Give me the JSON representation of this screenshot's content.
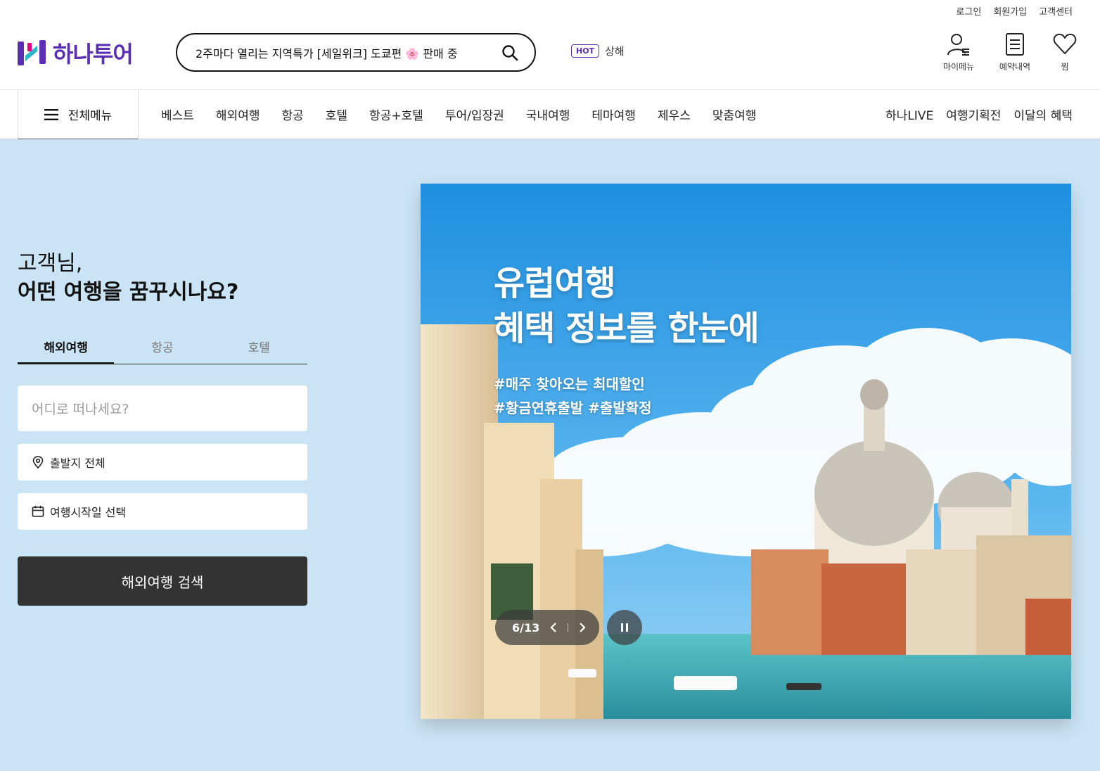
{
  "header": {
    "util_links": [
      "로그인",
      "회원가입",
      "고객센터"
    ],
    "logo_text": "하나투어",
    "search": {
      "text": "2주마다 열리는 지역특가 [세일위크] 도쿄편 🌸 판매 중"
    },
    "hot": {
      "badge": "HOT",
      "keyword": "상해"
    },
    "icons": [
      {
        "name": "mymenu",
        "label": "마이메뉴",
        "icon": "user-icon"
      },
      {
        "name": "reservations",
        "label": "예약내역",
        "icon": "document-icon"
      },
      {
        "name": "wishlist",
        "label": "찜",
        "icon": "heart-icon"
      }
    ]
  },
  "gnb": {
    "all_menu_label": "전체메뉴",
    "items": [
      "베스트",
      "해외여행",
      "항공",
      "호텔",
      "항공+호텔",
      "투어/입장권",
      "국내여행",
      "테마여행",
      "제우스",
      "맞춤여행"
    ],
    "right_items": [
      "하나LIVE",
      "여행기획전",
      "이달의 혜택"
    ]
  },
  "search_panel": {
    "greeting_line1": "고객님,",
    "greeting_line2": "어떤 여행을 꿈꾸시나요?",
    "tabs": [
      "해외여행",
      "항공",
      "호텔"
    ],
    "active_tab": "해외여행",
    "destination_placeholder": "어디로 떠나세요?",
    "origin": "출발지 전체",
    "date": "여행시작일 선택",
    "submit_label": "해외여행 검색"
  },
  "banner": {
    "title_line1": "유럽여행",
    "title_line2": "혜택 정보를 한눈에",
    "tag_line1": "#매주 찾아오는 최대할인",
    "tag_line2": "#황금연휴출발 #출발확정",
    "pager": "6/13"
  },
  "colors": {
    "brand": "#5a2fb3",
    "page_bg": "#cbe4f5",
    "button_dark": "#333333"
  }
}
